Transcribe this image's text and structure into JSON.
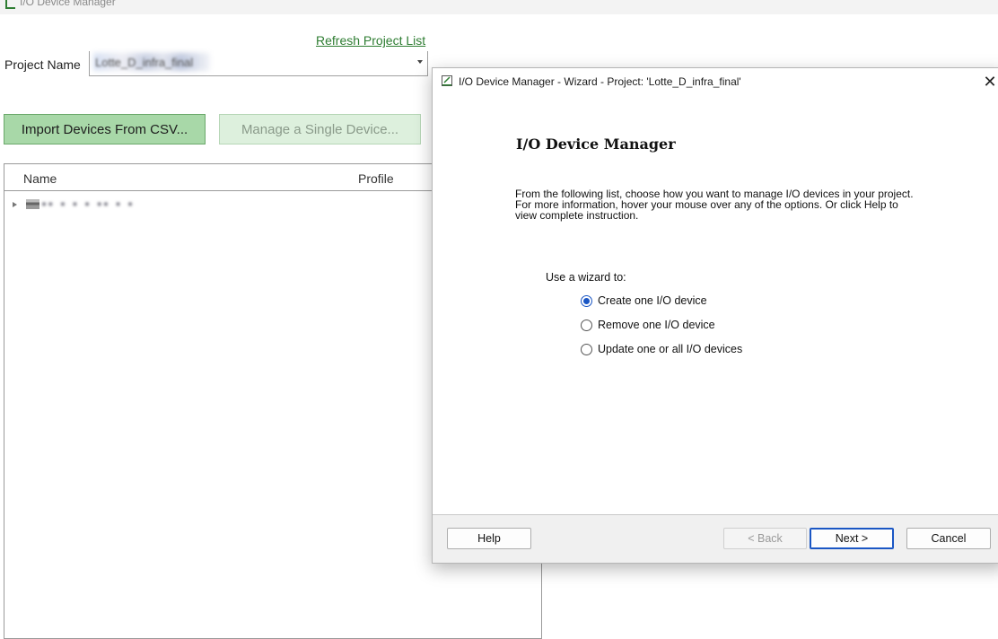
{
  "app": {
    "title": "I/O Device Manager",
    "refresh_link": "Refresh Project List",
    "project_label": "Project Name",
    "project_value": "Lotte_D_infra_final",
    "import_button": "Import Devices From CSV...",
    "manage_button": "Manage a Single Device...",
    "tree": {
      "columns": [
        "Name",
        "Profile"
      ],
      "rows": [
        {
          "label": "▪▪ ▪ ▪ ▪   ▪▪ ▪ ▪",
          "expanded": false
        }
      ]
    }
  },
  "wizard": {
    "title": "I/O Device Manager - Wizard - Project: 'Lotte_D_infra_final'",
    "close_glyph": "✕",
    "heading": "I/O Device Manager",
    "description": "From the following list, choose how you want to manage I/O devices in your project. For more information, hover your mouse over any of the options. Or click Help to view complete instruction.",
    "use_label": "Use a wizard to:",
    "options": [
      {
        "label": "Create one I/O device",
        "selected": true
      },
      {
        "label": "Remove one I/O device",
        "selected": false
      },
      {
        "label": "Update one or all I/O devices",
        "selected": false
      }
    ],
    "buttons": {
      "help": "Help",
      "back": "< Back",
      "next": "Next >",
      "cancel": "Cancel"
    }
  },
  "colors": {
    "accent": "#1a56c4",
    "import_button_bg": "#a8d8a8",
    "manage_button_bg": "#ddf0dd",
    "link": "#2e7d32"
  }
}
